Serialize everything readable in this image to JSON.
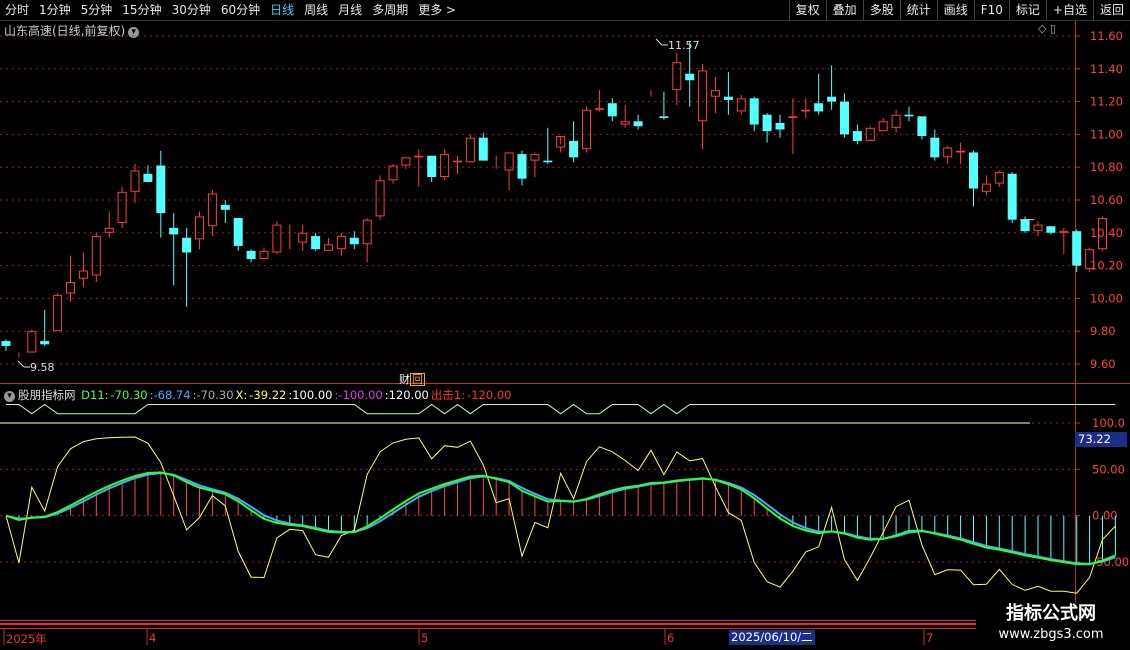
{
  "toolbar": {
    "periods": [
      "分时",
      "1分钟",
      "5分钟",
      "15分钟",
      "30分钟",
      "60分钟",
      "日线",
      "周线",
      "月线",
      "多周期",
      "更多 >"
    ],
    "active": "日线",
    "right_buttons": [
      "复权",
      "叠加",
      "多股",
      "统计",
      "画线",
      "F10",
      "标记",
      "+自选",
      "返回"
    ]
  },
  "main_chart": {
    "title": "山东高速(日线,前复权)",
    "y_ticks": [
      "11.60",
      "11.40",
      "11.20",
      "11.00",
      "10.80",
      "10.60",
      "10.40",
      "10.20",
      "10.00",
      "9.80",
      "9.60"
    ],
    "high_label": "11.57",
    "low_label": "9.58",
    "finance_label": "财",
    "colors": {
      "up": "#ff3c3c",
      "down": "#54ffff",
      "grid": "#8a1f1f",
      "axis": "#c0302a"
    }
  },
  "indicator": {
    "name": "股朋指标网",
    "items": [
      {
        "text": "D11:",
        "color": "#4cff4c"
      },
      {
        "text": "-70.30",
        "color": "#4cff4c"
      },
      {
        "text": ":-68.74",
        "color": "#4aa8ff"
      },
      {
        "text": ":-70.30",
        "color": "#aaaaaa"
      },
      {
        "text": "X:",
        "color": "#ffff66"
      },
      {
        "text": "-39.22",
        "color": "#ffff66"
      },
      {
        "text": ":100.00",
        "color": "#ffffff"
      },
      {
        "text": ":-100.00",
        "color": "#e040e0"
      },
      {
        "text": ":120.00",
        "color": "#ffffff"
      },
      {
        "text": "出击1:",
        "color": "#ff3030"
      },
      {
        "text": "-120.00",
        "color": "#ff3030"
      }
    ],
    "y_ticks": [
      "100.0",
      "50.00",
      "0.00",
      "-50.00"
    ],
    "current_value": "73.22"
  },
  "date_axis": {
    "labels": [
      {
        "text": "2025年"
      },
      {
        "text": "4"
      },
      {
        "text": "5"
      },
      {
        "text": "6"
      },
      {
        "text": "7"
      }
    ],
    "selected": "2025/06/10/二"
  },
  "watermark": {
    "line1": "指标公式网",
    "line2": "www.zbgs3.com"
  },
  "chart_data": {
    "type": "candlestick",
    "ohlc": [
      [
        9.74,
        9.71,
        9.75,
        9.68
      ],
      [
        9.66,
        9.66,
        9.67,
        9.64
      ],
      [
        9.67,
        9.8,
        9.81,
        9.67
      ],
      [
        9.74,
        9.72,
        9.93,
        9.71
      ],
      [
        9.8,
        10.02,
        10.03,
        9.8
      ],
      [
        10.03,
        10.1,
        10.26,
        9.98
      ],
      [
        10.12,
        10.17,
        10.28,
        10.07
      ],
      [
        10.14,
        10.38,
        10.4,
        10.1
      ],
      [
        10.4,
        10.43,
        10.53,
        10.37
      ],
      [
        10.46,
        10.65,
        10.68,
        10.43
      ],
      [
        10.65,
        10.78,
        10.82,
        10.58
      ],
      [
        10.76,
        10.71,
        10.81,
        10.71
      ],
      [
        10.81,
        10.52,
        10.9,
        10.37
      ],
      [
        10.43,
        10.39,
        10.52,
        10.08
      ],
      [
        10.37,
        10.28,
        10.43,
        9.95
      ],
      [
        10.36,
        10.5,
        10.53,
        10.3
      ],
      [
        10.44,
        10.64,
        10.66,
        10.38
      ],
      [
        10.57,
        10.54,
        10.6,
        10.46
      ],
      [
        10.49,
        10.32,
        10.49,
        10.29
      ],
      [
        10.29,
        10.24,
        10.3,
        10.22
      ],
      [
        10.24,
        10.29,
        10.31,
        10.24
      ],
      [
        10.28,
        10.45,
        10.47,
        10.27
      ],
      [
        10.42,
        10.42,
        10.45,
        10.3
      ],
      [
        10.34,
        10.4,
        10.45,
        10.29
      ],
      [
        10.38,
        10.3,
        10.4,
        10.29
      ],
      [
        10.29,
        10.33,
        10.37,
        10.29
      ],
      [
        10.3,
        10.38,
        10.4,
        10.26
      ],
      [
        10.37,
        10.33,
        10.41,
        10.3
      ],
      [
        10.33,
        10.48,
        10.49,
        10.22
      ],
      [
        10.5,
        10.72,
        10.75,
        10.48
      ],
      [
        10.72,
        10.81,
        10.82,
        10.7
      ],
      [
        10.81,
        10.86,
        10.86,
        10.79
      ],
      [
        10.86,
        10.87,
        10.91,
        10.68
      ],
      [
        10.87,
        10.74,
        10.87,
        10.71
      ],
      [
        10.74,
        10.88,
        10.91,
        10.72
      ],
      [
        10.83,
        10.84,
        10.87,
        10.76
      ],
      [
        10.83,
        10.98,
        11.0,
        10.83
      ],
      [
        10.98,
        10.84,
        11.01,
        10.84
      ],
      [
        10.83,
        10.83,
        10.87,
        10.79
      ],
      [
        10.78,
        10.89,
        10.89,
        10.66
      ],
      [
        10.88,
        10.73,
        10.9,
        10.69
      ],
      [
        10.84,
        10.88,
        10.89,
        10.74
      ],
      [
        10.84,
        10.83,
        11.04,
        10.82
      ],
      [
        10.92,
        10.99,
        10.94,
        10.89
      ],
      [
        10.96,
        10.86,
        11.08,
        10.83
      ],
      [
        10.91,
        11.15,
        11.17,
        10.89
      ],
      [
        11.15,
        11.16,
        11.27,
        11.14
      ],
      [
        11.19,
        11.11,
        11.22,
        11.08
      ],
      [
        11.06,
        11.08,
        11.18,
        11.04
      ],
      [
        11.08,
        11.05,
        11.12,
        11.03
      ],
      [
        11.24,
        11.24,
        11.27,
        11.23
      ],
      [
        11.11,
        11.1,
        11.26,
        11.09
      ],
      [
        11.27,
        11.44,
        11.5,
        11.18
      ],
      [
        11.37,
        11.33,
        11.57,
        11.17
      ],
      [
        11.08,
        11.39,
        11.43,
        10.91
      ],
      [
        11.23,
        11.27,
        11.35,
        11.13
      ],
      [
        11.23,
        11.21,
        11.38,
        11.12
      ],
      [
        11.14,
        11.22,
        11.24,
        11.12
      ],
      [
        11.22,
        11.06,
        11.23,
        11.02
      ],
      [
        11.12,
        11.02,
        11.13,
        10.95
      ],
      [
        11.07,
        11.03,
        11.12,
        10.98
      ],
      [
        11.1,
        11.11,
        11.22,
        10.88
      ],
      [
        11.14,
        11.15,
        11.22,
        11.1
      ],
      [
        11.19,
        11.14,
        11.37,
        11.12
      ],
      [
        11.23,
        11.2,
        11.42,
        11.15
      ],
      [
        11.2,
        11.0,
        11.25,
        10.98
      ],
      [
        11.02,
        10.96,
        11.06,
        10.94
      ],
      [
        10.96,
        11.04,
        11.05,
        10.97
      ],
      [
        11.02,
        11.08,
        11.1,
        11.02
      ],
      [
        11.04,
        11.12,
        11.15,
        11.01
      ],
      [
        11.12,
        11.11,
        11.17,
        11.08
      ],
      [
        11.11,
        10.99,
        11.11,
        10.97
      ],
      [
        10.98,
        10.86,
        11.03,
        10.84
      ],
      [
        10.86,
        10.92,
        10.93,
        10.82
      ],
      [
        10.89,
        10.9,
        10.95,
        10.82
      ],
      [
        10.89,
        10.67,
        10.9,
        10.56
      ],
      [
        10.65,
        10.7,
        10.75,
        10.63
      ],
      [
        10.7,
        10.77,
        10.78,
        10.68
      ],
      [
        10.76,
        10.48,
        10.77,
        10.46
      ],
      [
        10.48,
        10.41,
        10.5,
        10.4
      ],
      [
        10.41,
        10.45,
        10.47,
        10.38
      ],
      [
        10.44,
        10.4,
        10.42,
        10.39
      ],
      [
        10.4,
        10.41,
        10.43,
        10.27
      ],
      [
        10.41,
        10.2,
        10.42,
        10.16
      ],
      [
        10.18,
        10.3,
        10.31,
        10.16
      ],
      [
        10.3,
        10.49,
        10.5,
        10.29
      ],
      [
        10.48,
        10.48,
        10.48,
        10.48
      ]
    ],
    "indicator_lines": {
      "D11": "-70.30",
      "MA": "-68.74",
      "X": "-39.22",
      "upper": "100.00",
      "lower": "-100.00",
      "top": "120.00"
    }
  }
}
